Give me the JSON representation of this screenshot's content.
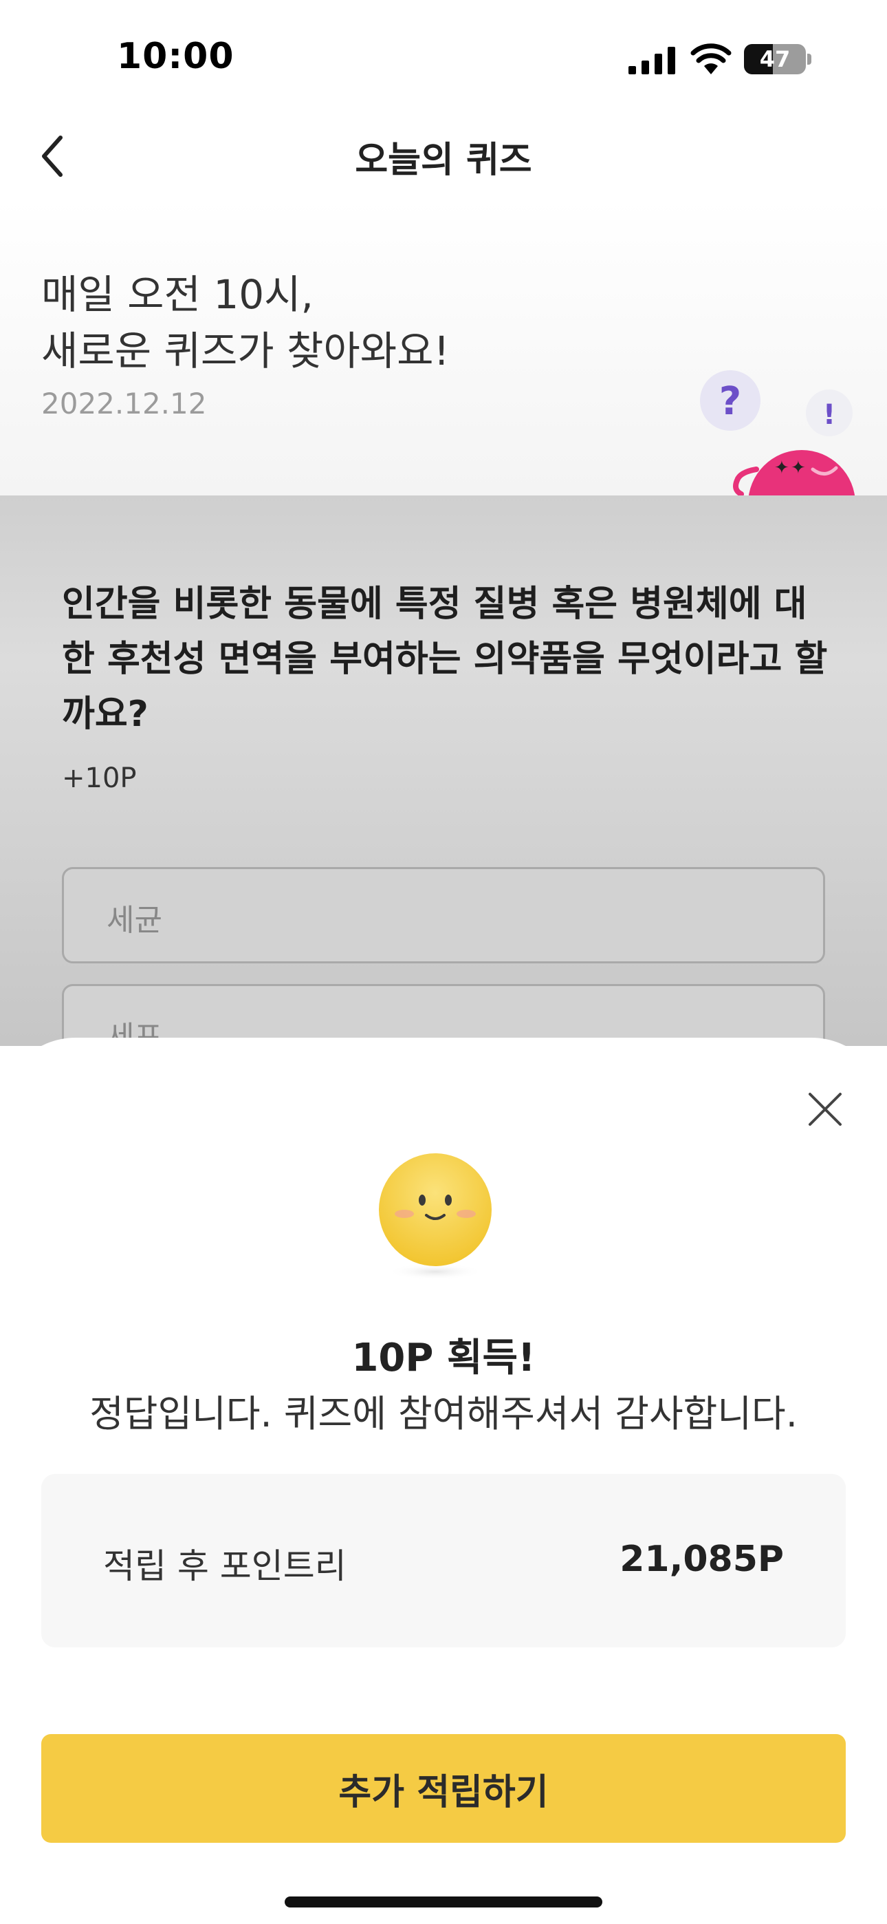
{
  "status_bar": {
    "time": "10:00",
    "battery_level": "47",
    "battery_fraction": 0.47,
    "icons": [
      "signal-icon",
      "wifi-icon",
      "battery-icon"
    ]
  },
  "header": {
    "title": "오늘의 퀴즈",
    "back_icon": "chevron-left-icon"
  },
  "intro": {
    "line1": "매일 오전 10시,",
    "line2": "새로운 퀴즈가 찾아와요!",
    "date": "2022.12.12",
    "mascot_marks": [
      "?",
      "!"
    ]
  },
  "quiz": {
    "question": "인간을 비롯한 동물에 특정 질병 혹은 병원체에 대한 후천성 면역을 부여하는 의약품을 무엇이라고 할까요?",
    "points": "+10P",
    "options": [
      {
        "label": "세균"
      },
      {
        "label": "세포"
      }
    ]
  },
  "result_sheet": {
    "close_icon": "close-icon",
    "emoji_icon": "smiley-face-icon",
    "title": "10P 획득!",
    "message": "정답입니다. 퀴즈에 참여해주셔서 감사합니다.",
    "balance_label": "적립 후 포인트리",
    "balance_value": "21,085P",
    "button_label": "추가 적립하기"
  },
  "colors": {
    "accent_yellow": "#f5cb44",
    "mascot_pink": "#e8327a",
    "question_purple": "#6c4fc8",
    "dim_overlay": "#cfcfcf"
  }
}
